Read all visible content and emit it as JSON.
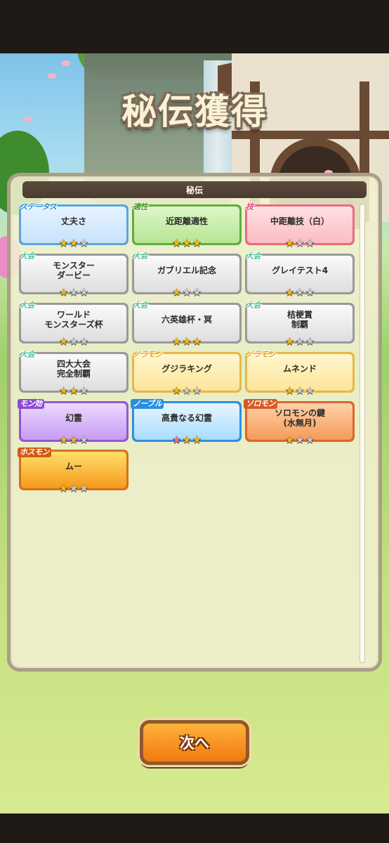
{
  "title": "秘伝獲得",
  "panel": {
    "header": "秘伝"
  },
  "cards": [
    {
      "tag": "ステータス",
      "name": "丈夫さ",
      "style": "blue",
      "stars": [
        1,
        1,
        0
      ]
    },
    {
      "tag": "適性",
      "name": "近距離適性",
      "style": "green",
      "stars": [
        1,
        1,
        1
      ]
    },
    {
      "tag": "技",
      "name": "中距離技（白）",
      "style": "pink",
      "stars": [
        1,
        0,
        0
      ]
    },
    {
      "tag": "大会",
      "name": "モンスター\nダービー",
      "style": "grey",
      "stars": [
        1,
        0,
        0
      ]
    },
    {
      "tag": "大会",
      "name": "ガブリエル記念",
      "style": "grey",
      "stars": [
        1,
        0,
        0
      ]
    },
    {
      "tag": "大会",
      "name": "グレイテスト4",
      "style": "grey",
      "stars": [
        1,
        0,
        0
      ]
    },
    {
      "tag": "大会",
      "name": "ワールド\nモンスターズ杯",
      "style": "grey",
      "stars": [
        1,
        0,
        0
      ]
    },
    {
      "tag": "大会",
      "name": "六英雄杯・冥",
      "style": "grey",
      "stars": [
        1,
        1,
        1
      ]
    },
    {
      "tag": "大会",
      "name": "桔梗賞\n制覇",
      "style": "grey",
      "stars": [
        1,
        0,
        0
      ]
    },
    {
      "tag": "大会",
      "name": "四大大会\n完全制覇",
      "style": "grey",
      "stars": [
        1,
        1,
        0
      ]
    },
    {
      "tag": "ノラモン",
      "name": "グジラキング",
      "style": "yellow",
      "stars": [
        1,
        0,
        0
      ]
    },
    {
      "tag": "ノラモン",
      "name": "ムネンド",
      "style": "yellow",
      "stars": [
        1,
        0,
        0
      ]
    },
    {
      "tag": "モン効",
      "name": "幻霊",
      "style": "purple",
      "stars": [
        1,
        1,
        0
      ]
    },
    {
      "tag": "ノーブル",
      "name": "高貴なる幻霊",
      "style": "cyan",
      "stars": [
        2,
        1,
        1
      ]
    },
    {
      "tag": "ソロモン",
      "name": "ソロモンの鍵\n(水無月)",
      "style": "orange",
      "stars": [
        1,
        0,
        0
      ]
    },
    {
      "tag": "ホスモン",
      "name": "ムー",
      "style": "fire",
      "stars": [
        1,
        0,
        0
      ]
    }
  ],
  "next_button": {
    "label": "次へ"
  }
}
